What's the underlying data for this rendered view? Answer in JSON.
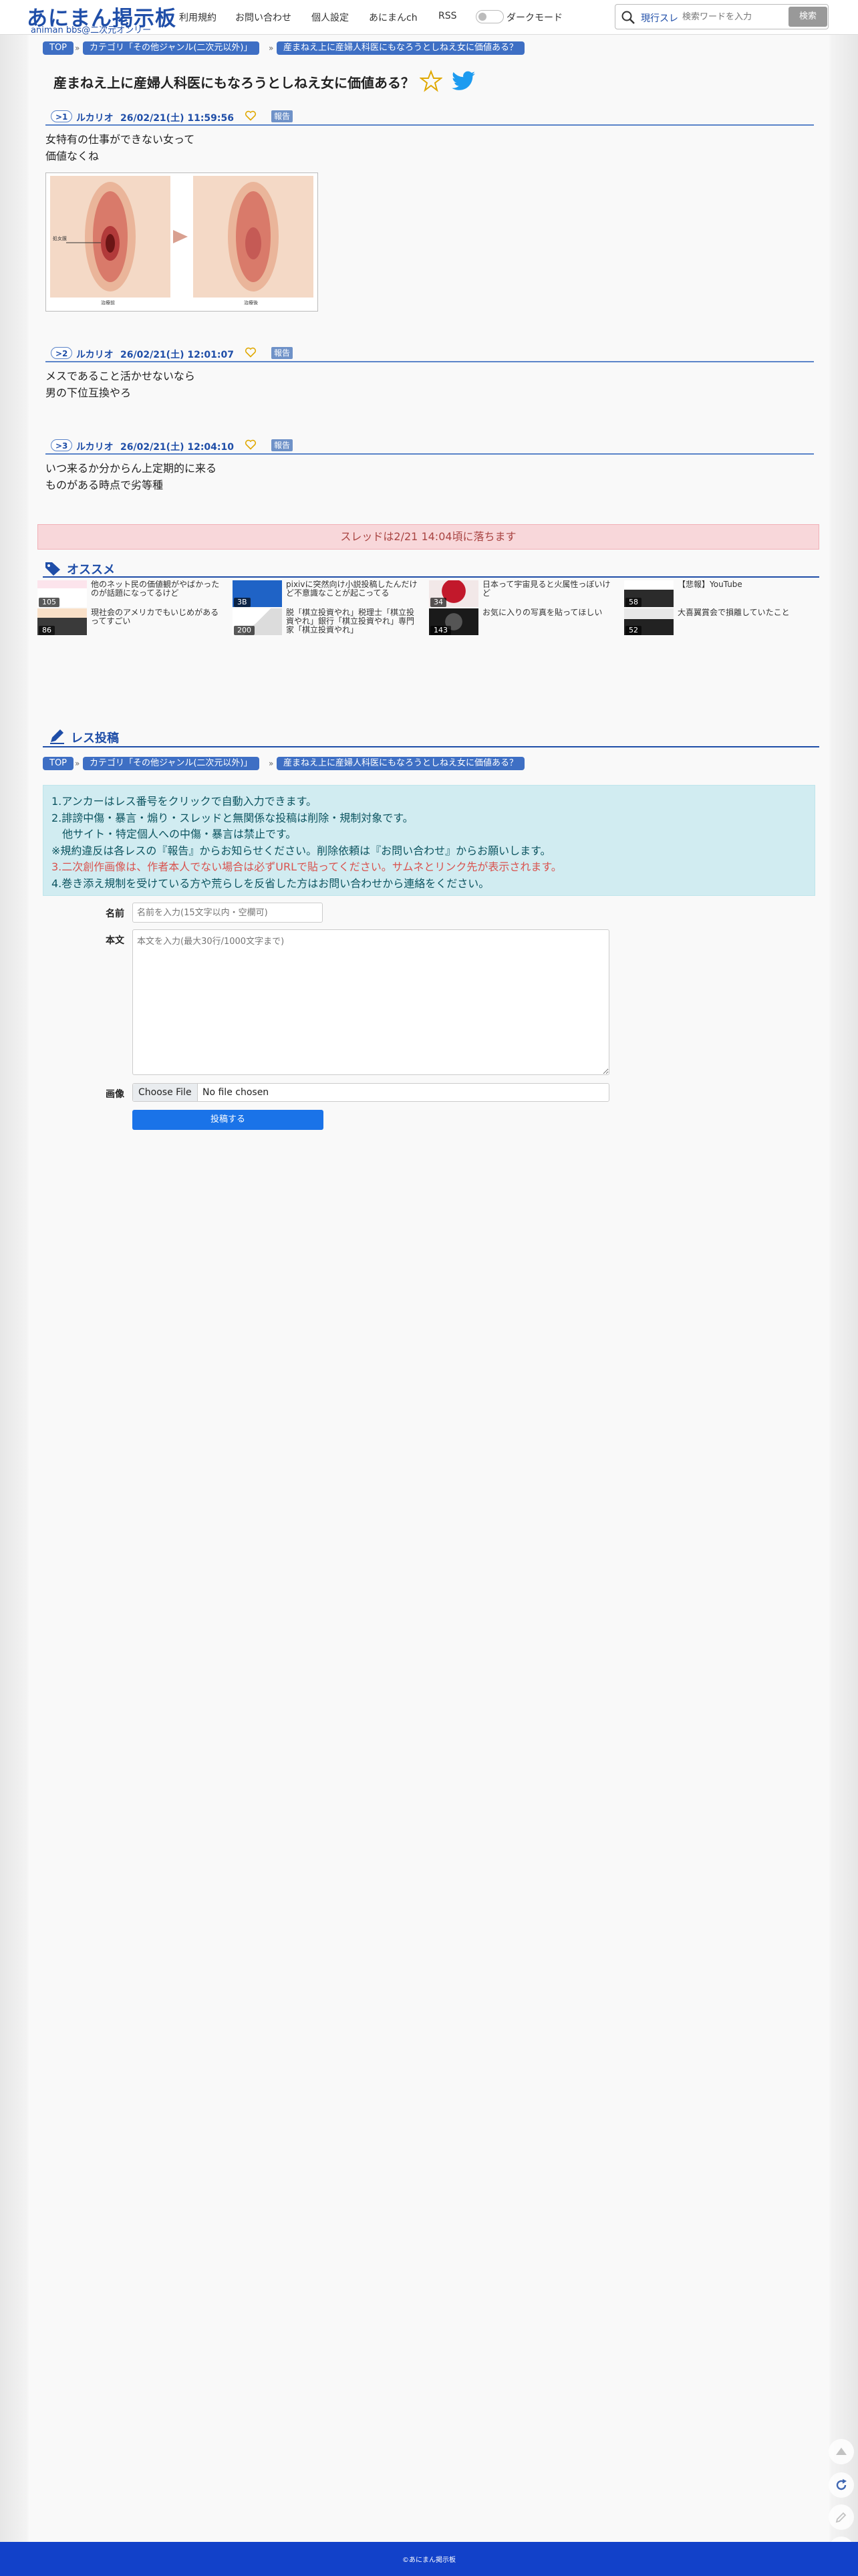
{
  "header": {
    "logo_main": "あにまん掲示板",
    "logo_sub": "animan bbs@二次元オンリー",
    "nav": [
      "利用規約",
      "お問い合わせ",
      "個人設定",
      "あにまんch",
      "RSS"
    ],
    "dark_mode_label": "ダークモード",
    "search_scope": "現行スレ",
    "search_placeholder": "検索ワードを入力",
    "search_button": "検索"
  },
  "breadcrumb": [
    "TOP",
    "カテゴリ「その他ジャンル(二次元以外)」",
    "産まねえ上に産婦人科医にもなろうとしねえ女に価値ある？"
  ],
  "breadcrumb_sep": "»",
  "thread": {
    "title": "産まねえ上に産婦人科医にもなろうとしねえ女に価値ある？"
  },
  "posts": [
    {
      "num": ">1",
      "name": "ルカリオ",
      "date": "26/02/21(土) 11:59:56",
      "report": "報告",
      "lines": [
        "女特有の仕事ができない女って",
        "価値なくね"
      ]
    },
    {
      "num": ">2",
      "name": "ルカリオ",
      "date": "26/02/21(土) 12:01:07",
      "report": "報告",
      "lines": [
        "メスであること活かせないなら",
        "男の下位互換やろ"
      ]
    },
    {
      "num": ">3",
      "name": "ルカリオ",
      "date": "26/02/21(土) 12:04:10",
      "report": "報告",
      "lines": [
        "いつ来るか分からん上定期的に来る",
        "ものがある時点で劣等種"
      ]
    }
  ],
  "image": {
    "label_left": "処女膜",
    "caption_left": "治療前",
    "caption_right": "治療後"
  },
  "thread_drop": "スレッドは2/21 14:04頃に落ちます",
  "osusume": {
    "title": "オススメ",
    "items": [
      {
        "title": "他のネット民の価値観がやばかったのが話題になってるけど",
        "count": "105"
      },
      {
        "title": "pixivに突然向け小説投稿したんだけど不意識なことが起こってる",
        "count": "3B"
      },
      {
        "title": "日本って宇宙見ると火属性っぽいけど",
        "count": "34"
      },
      {
        "title": "【悲報】YouTube",
        "count": "58"
      },
      {
        "title": "現社会のアメリカでもいじめがあるってすごい",
        "count": "86"
      },
      {
        "title": "脱「棋立投資やれ」税理士「棋立投資やれ」銀行「棋立投資やれ」専門家「棋立投資やれ」",
        "count": "200"
      },
      {
        "title": "お気に入りの写真を貼ってほしい",
        "count": "143"
      },
      {
        "title": "大喜翼賞会で損離していたこと",
        "count": "52"
      }
    ]
  },
  "reply": {
    "title": "レス投稿",
    "rules": [
      "1.アンカーはレス番号をクリックで自動入力できます。",
      "2.誹謗中傷・暴言・煽り・スレッドと無関係な投稿は削除・規制対象です。",
      "　他サイト・特定個人への中傷・暴言は禁止です。",
      "※規約違反は各レスの『報告』からお知らせください。削除依頼は『お問い合わせ』からお願いします。",
      "3.二次創作画像は、作者本人でない場合は必ずURLで貼ってください。サムネとリンク先が表示されます。",
      "4.巻き添え規制を受けている方や荒らしを反省した方はお問い合わせから連絡をください。"
    ],
    "name_label": "名前",
    "name_placeholder": "名前を入力(15文字以内・空欄可)",
    "body_label": "本文",
    "body_placeholder": "本文を入力(最大30行/1000文字まで)",
    "image_label": "画像",
    "file_button": "Choose File",
    "file_status": "No file chosen",
    "submit": "投稿する"
  },
  "footer": "©あにまん掲示板",
  "colors": {
    "accent": "#1f4ea8",
    "crumb": "#3e6fc4",
    "footer": "#1241c9",
    "submit": "#1a73e8"
  }
}
